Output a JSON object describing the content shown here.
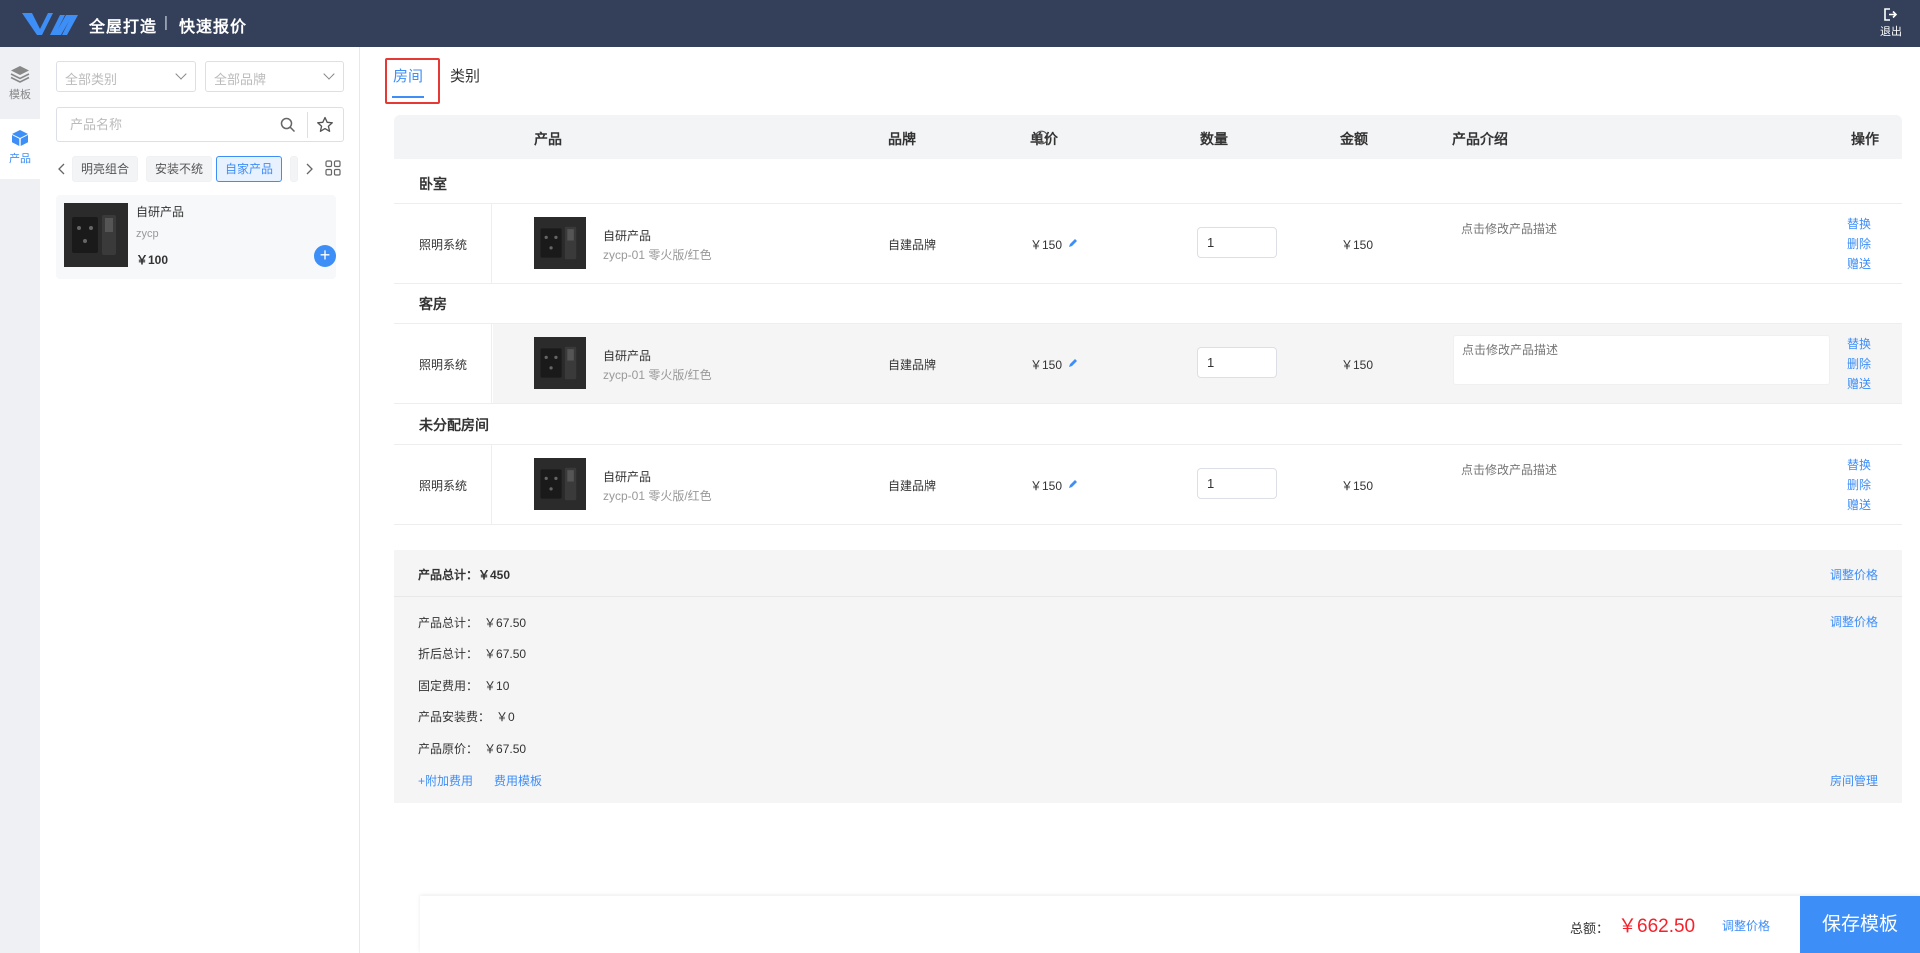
{
  "header": {
    "app_title": "全屋打造",
    "separator": "|",
    "page_title": "快速报价",
    "logout_label": "退出"
  },
  "rail": {
    "items": [
      {
        "label": "模板",
        "icon": "layers-icon"
      },
      {
        "label": "产品",
        "icon": "cube-icon"
      }
    ]
  },
  "product_panel": {
    "category_select": "全部类别",
    "brand_select": "全部品牌",
    "search_placeholder": "产品名称",
    "chips": [
      "明亮组合",
      "安装不统",
      "自家产品",
      ""
    ],
    "active_chip": "自家产品",
    "card": {
      "name": "自研产品",
      "code": "zycp",
      "price": "￥100",
      "add": "+"
    }
  },
  "tabs": [
    "房间",
    "类别"
  ],
  "active_tab": "房间",
  "table": {
    "headers": {
      "product": "产品",
      "brand": "品牌",
      "unit_price": "单价",
      "quantity": "数量",
      "amount": "金额",
      "description": "产品介绍",
      "actions": "操作"
    },
    "rooms": [
      {
        "name": "卧室",
        "items": [
          {
            "category": "照明系统",
            "name": "自研产品",
            "spec": "zycp-01 零火版/红色",
            "brand": "自建品牌",
            "unit_price": "￥150",
            "quantity": "1",
            "amount": "￥150",
            "description_placeholder": "点击修改产品描述",
            "actions": [
              "替换",
              "删除",
              "赠送"
            ]
          }
        ]
      },
      {
        "name": "客房",
        "items": [
          {
            "category": "照明系统",
            "name": "自研产品",
            "spec": "zycp-01 零火版/红色",
            "brand": "自建品牌",
            "unit_price": "￥150",
            "quantity": "1",
            "amount": "￥150",
            "description_placeholder": "点击修改产品描述",
            "actions": [
              "替换",
              "删除",
              "赠送"
            ]
          }
        ]
      },
      {
        "name": "未分配房间",
        "items": [
          {
            "category": "照明系统",
            "name": "自研产品",
            "spec": "zycp-01 零火版/红色",
            "brand": "自建品牌",
            "unit_price": "￥150",
            "quantity": "1",
            "amount": "￥150",
            "description_placeholder": "点击修改产品描述",
            "actions": [
              "替换",
              "删除",
              "赠送"
            ]
          }
        ]
      }
    ]
  },
  "summary": {
    "head_total": "产品总计：￥450",
    "adjust_label": "调整价格",
    "lines": [
      {
        "label": "产品总计：",
        "value": "￥67.50"
      },
      {
        "label": "折后总计：",
        "value": "￥67.50"
      },
      {
        "label": "固定费用：",
        "value": "￥10"
      },
      {
        "label": "产品安装费：",
        "value": "￥0"
      },
      {
        "label": "产品原价：",
        "value": "￥67.50"
      }
    ],
    "add_fee": "+附加费用",
    "fee_template": "费用模板",
    "room_manage": "房间管理"
  },
  "footer": {
    "total_label": "总额：",
    "total_value": "￥662.50",
    "adjust_label": "调整价格",
    "save_label": "保存模板"
  },
  "colors": {
    "header_bg": "#34405a",
    "accent": "#3e8ef7",
    "total_red": "#f5222d",
    "highlight_border": "#e53935"
  }
}
